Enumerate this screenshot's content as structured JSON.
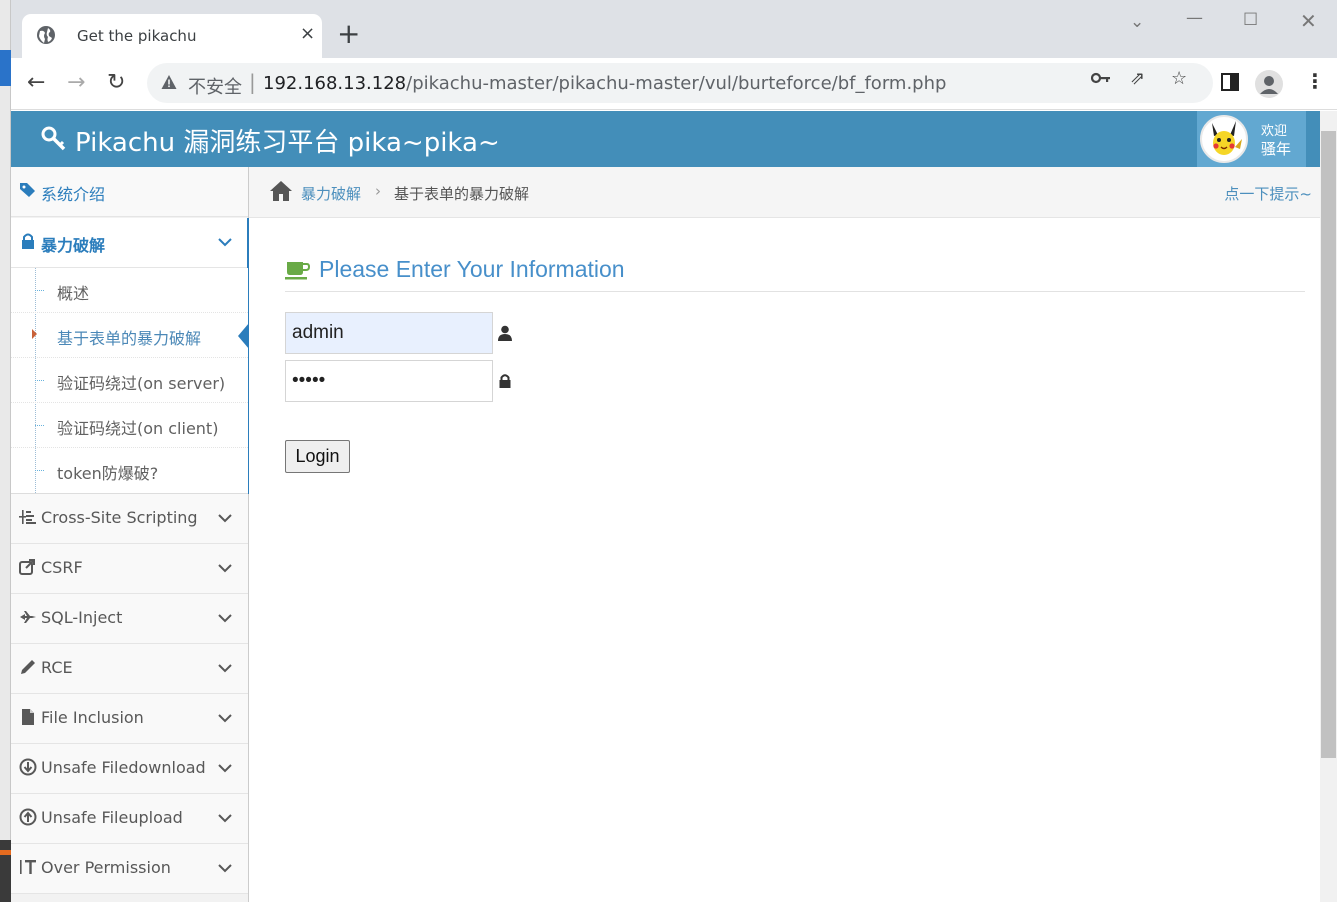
{
  "browser": {
    "tab_title": "Get the pikachu",
    "tab_close": "×",
    "new_tab": "+",
    "insecure_label": "不安全",
    "url_host": "192.168.13.128",
    "url_path": "/pikachu-master/pikachu-master/vul/burteforce/bf_form.php"
  },
  "header": {
    "brand": "Pikachu 漏洞练习平台 pika~pika~",
    "welcome": "欢迎",
    "username": "骚年"
  },
  "sidebar": {
    "items": [
      {
        "label": "系统介绍",
        "icon": "tags-icon"
      },
      {
        "label": "暴力破解",
        "icon": "lock-icon"
      },
      {
        "label": "Cross-Site Scripting",
        "icon": "xss-icon"
      },
      {
        "label": "CSRF",
        "icon": "share-icon"
      },
      {
        "label": "SQL-Inject",
        "icon": "fighter-jet-icon"
      },
      {
        "label": "RCE",
        "icon": "pencil-icon"
      },
      {
        "label": "File Inclusion",
        "icon": "file-icon"
      },
      {
        "label": "Unsafe Filedownload",
        "icon": "download-circle-icon"
      },
      {
        "label": "Unsafe Fileupload",
        "icon": "upload-circle-icon"
      },
      {
        "label": "Over Permission",
        "icon": "text-height-icon"
      }
    ],
    "sub_items": [
      {
        "label": "概述"
      },
      {
        "label": "基于表单的暴力破解"
      },
      {
        "label": "验证码绕过(on server)"
      },
      {
        "label": "验证码绕过(on client)"
      },
      {
        "label": "token防爆破?"
      }
    ]
  },
  "breadcrumbs": {
    "parent": "暴力破解",
    "separator": "›",
    "current": "基于表单的暴力破解",
    "hint": "点一下提示~"
  },
  "form": {
    "title": "Please Enter Your Information",
    "username_value": "admin",
    "password_value": "•••••",
    "login_label": "Login"
  },
  "colors": {
    "header_bg": "#438eb9",
    "accent": "#478fca",
    "active_nav": "#2b7dbc"
  }
}
